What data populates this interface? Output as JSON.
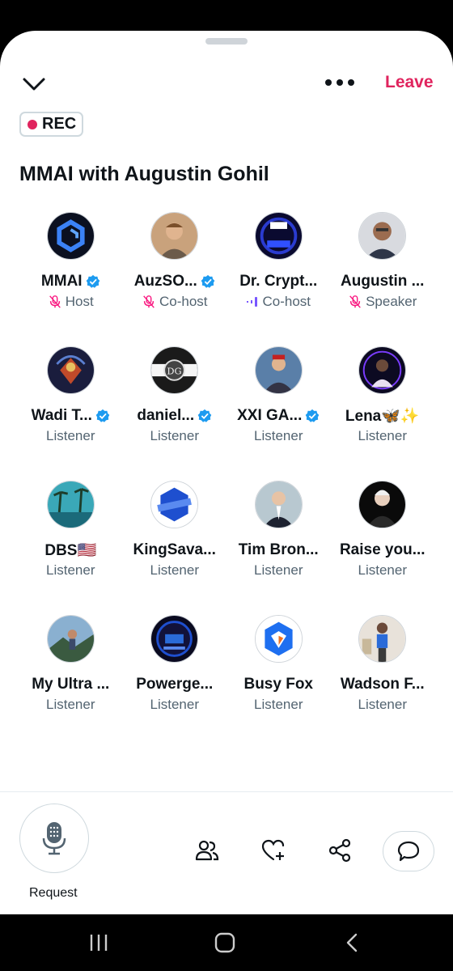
{
  "header": {
    "collapse_icon": "chevron-down-icon",
    "more_icon": "more-dots-icon",
    "leave_label": "Leave",
    "rec_label": "REC",
    "title": "MMAI with Augustin Gohil"
  },
  "colors": {
    "accent_red": "#e0245e",
    "verified_blue": "#1d9bf0",
    "mic_muted_pink": "#f91880",
    "speaking_purple": "#7856ff",
    "secondary_text": "#536471"
  },
  "participants": [
    {
      "name": "MMAI",
      "role": "Host",
      "verified": true,
      "status_icon": "mic-off-icon"
    },
    {
      "name": "AuzSO...",
      "role": "Co-host",
      "verified": true,
      "status_icon": "mic-off-icon"
    },
    {
      "name": "Dr. Crypt...",
      "role": "Co-host",
      "verified": false,
      "status_icon": "speaking-icon"
    },
    {
      "name": "Augustin ...",
      "role": "Speaker",
      "verified": false,
      "status_icon": "mic-off-icon"
    },
    {
      "name": "Wadi T...",
      "role": "Listener",
      "verified": true
    },
    {
      "name": "daniel...",
      "role": "Listener",
      "verified": true
    },
    {
      "name": "XXI GA...",
      "role": "Listener",
      "verified": true
    },
    {
      "name": "Lena🦋✨",
      "role": "Listener",
      "verified": false
    },
    {
      "name": "DBS🇺🇸",
      "role": "Listener",
      "verified": false
    },
    {
      "name": "KingSava...",
      "role": "Listener",
      "verified": false
    },
    {
      "name": "Tim Bron...",
      "role": "Listener",
      "verified": false
    },
    {
      "name": "Raise you...",
      "role": "Listener",
      "verified": false
    },
    {
      "name": "My Ultra ...",
      "role": "Listener",
      "verified": false
    },
    {
      "name": "Powerge...",
      "role": "Listener",
      "verified": false
    },
    {
      "name": "Busy Fox",
      "role": "Listener",
      "verified": false
    },
    {
      "name": "Wadson F...",
      "role": "Listener",
      "verified": false
    }
  ],
  "bottom_bar": {
    "request_label": "Request",
    "request_icon": "microphone-icon",
    "actions": [
      "people-icon",
      "heart-plus-icon",
      "share-icon",
      "chat-bubble-icon"
    ]
  },
  "system_nav": [
    "recent-apps-icon",
    "home-icon",
    "back-icon"
  ]
}
